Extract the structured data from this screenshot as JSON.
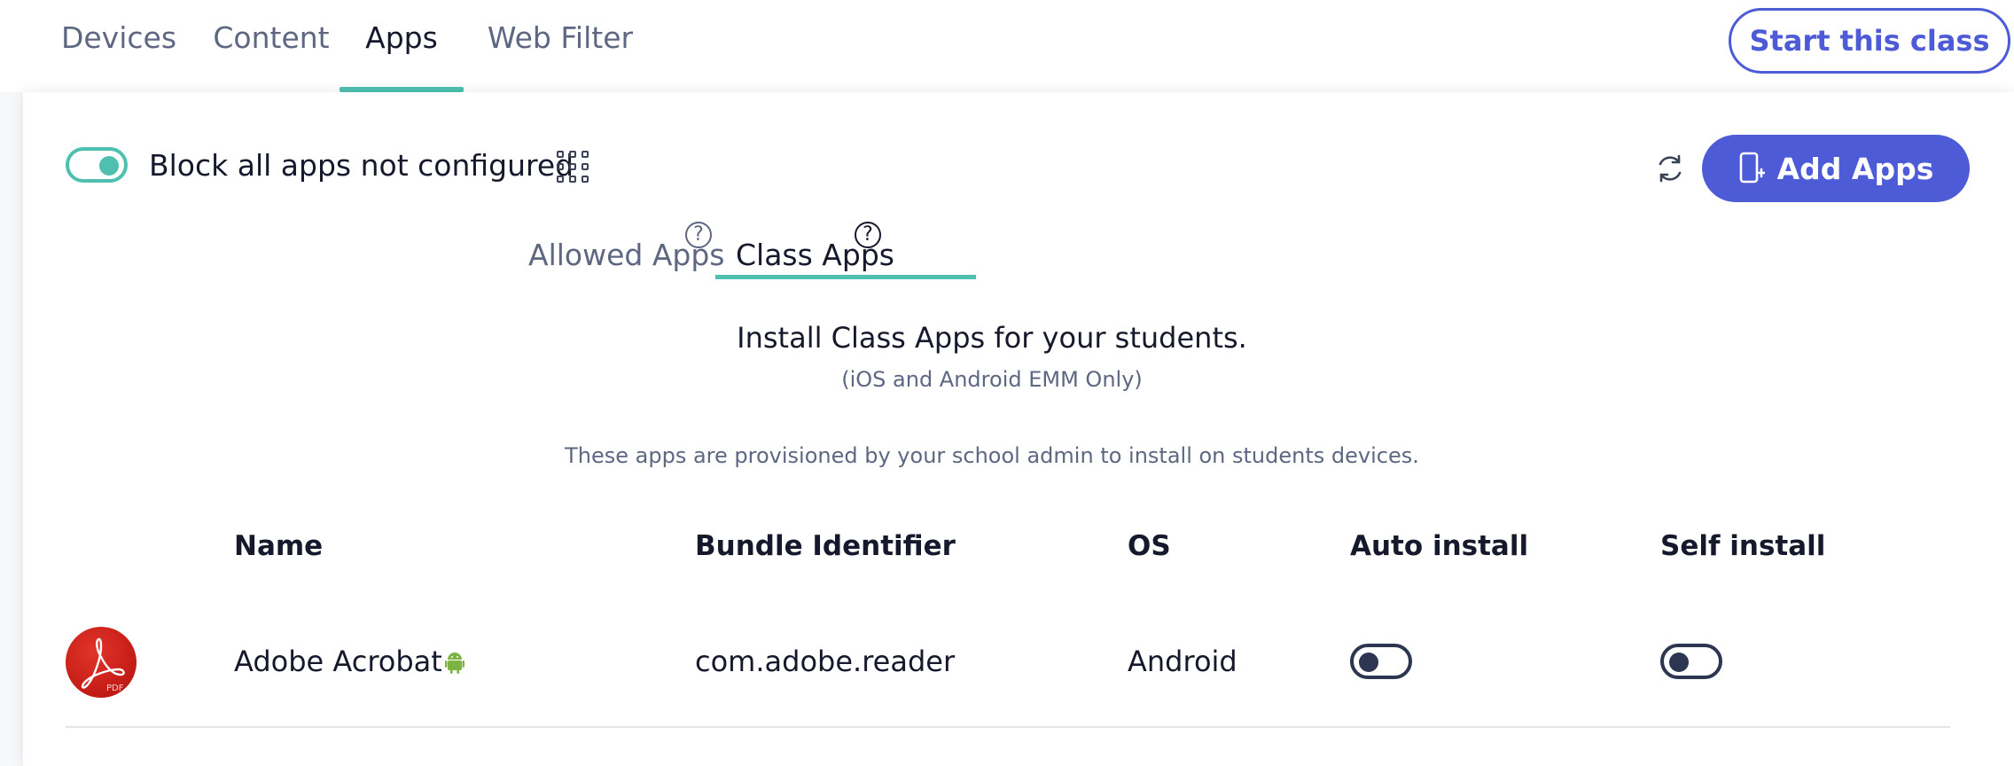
{
  "nav": {
    "tabs": [
      {
        "label": "Devices"
      },
      {
        "label": "Content"
      },
      {
        "label": "Apps"
      },
      {
        "label": "Web Filter"
      }
    ],
    "active_tab": "Apps",
    "start_button": "Start this class"
  },
  "toolbar": {
    "block_toggle_on": true,
    "block_label": "Block all apps not configured",
    "grid_icon": "grid-icon",
    "refresh_icon": "refresh-icon",
    "add_button": "Add Apps"
  },
  "subtabs": [
    {
      "label": "Allowed Apps",
      "help": "?"
    },
    {
      "label": "Class Apps",
      "help": "?"
    }
  ],
  "active_subtab": "Class Apps",
  "info": {
    "title": "Install Class Apps for your students.",
    "subtitle": "(iOS and Android EMM Only)",
    "provision_note": "These apps are provisioned by your school admin to install on students devices."
  },
  "table": {
    "headers": {
      "name": "Name",
      "bundle": "Bundle Identifier",
      "os": "OS",
      "auto": "Auto install",
      "self": "Self install"
    },
    "rows": [
      {
        "name": "Adobe Acrobat",
        "platform_icon": "android-icon",
        "logo_text": "PDF",
        "bundle": "com.adobe.reader",
        "os": "Android",
        "auto_install": false,
        "self_install": false
      }
    ]
  },
  "colors": {
    "accent_teal": "#4fc0b0",
    "primary_blue": "#4d5bd6",
    "text_dark": "#16192b",
    "text_muted": "#5d6781",
    "android_green": "#7cb342"
  }
}
